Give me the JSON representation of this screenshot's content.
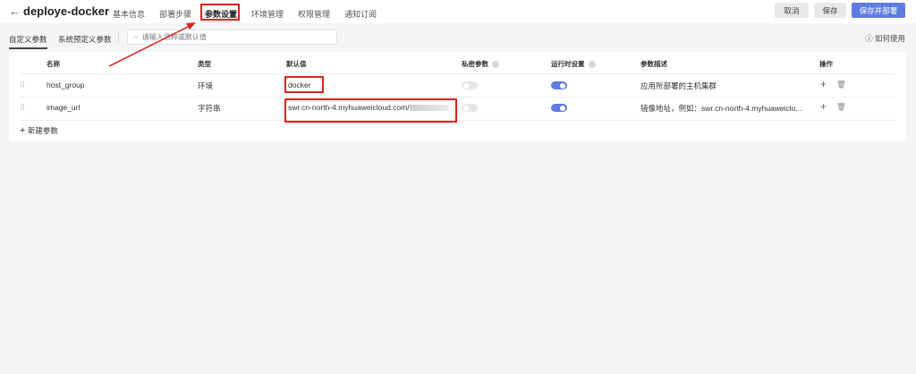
{
  "header": {
    "back_icon": "arrow-left-icon",
    "title": "deploye-docker",
    "tabs": [
      {
        "label": "基本信息"
      },
      {
        "label": "部署步骤"
      },
      {
        "label": "参数设置",
        "active": true
      },
      {
        "label": "环境管理"
      },
      {
        "label": "权限管理"
      },
      {
        "label": "通知订阅"
      }
    ],
    "buttons": {
      "cancel": "取消",
      "save": "保存",
      "save_deploy": "保存并部署"
    }
  },
  "toolbar": {
    "subtabs": [
      {
        "label": "自定义参数",
        "active": true
      },
      {
        "label": "系统预定义参数"
      }
    ],
    "search_placeholder": "请输入名称或默认值",
    "help": "如何使用"
  },
  "table": {
    "columns": [
      "名称",
      "类型",
      "默认值",
      "私密参数",
      "运行时设置",
      "参数描述",
      "操作"
    ],
    "rows": [
      {
        "name": "host_group",
        "type": "环境",
        "default": "docker",
        "private": false,
        "runtime": true,
        "description": "应用所部署的主机集群"
      },
      {
        "name": "image_url",
        "type": "字符串",
        "default": "swr.cn-north-4.myhuaweicloud.com/",
        "private": false,
        "runtime": true,
        "description": "镜像地址，例如：swr.cn-north-4.myhuaweiclo..."
      }
    ],
    "new_param": "新建参数"
  },
  "colors": {
    "accent": "#5e7ce0",
    "annotation": "#e02020"
  }
}
